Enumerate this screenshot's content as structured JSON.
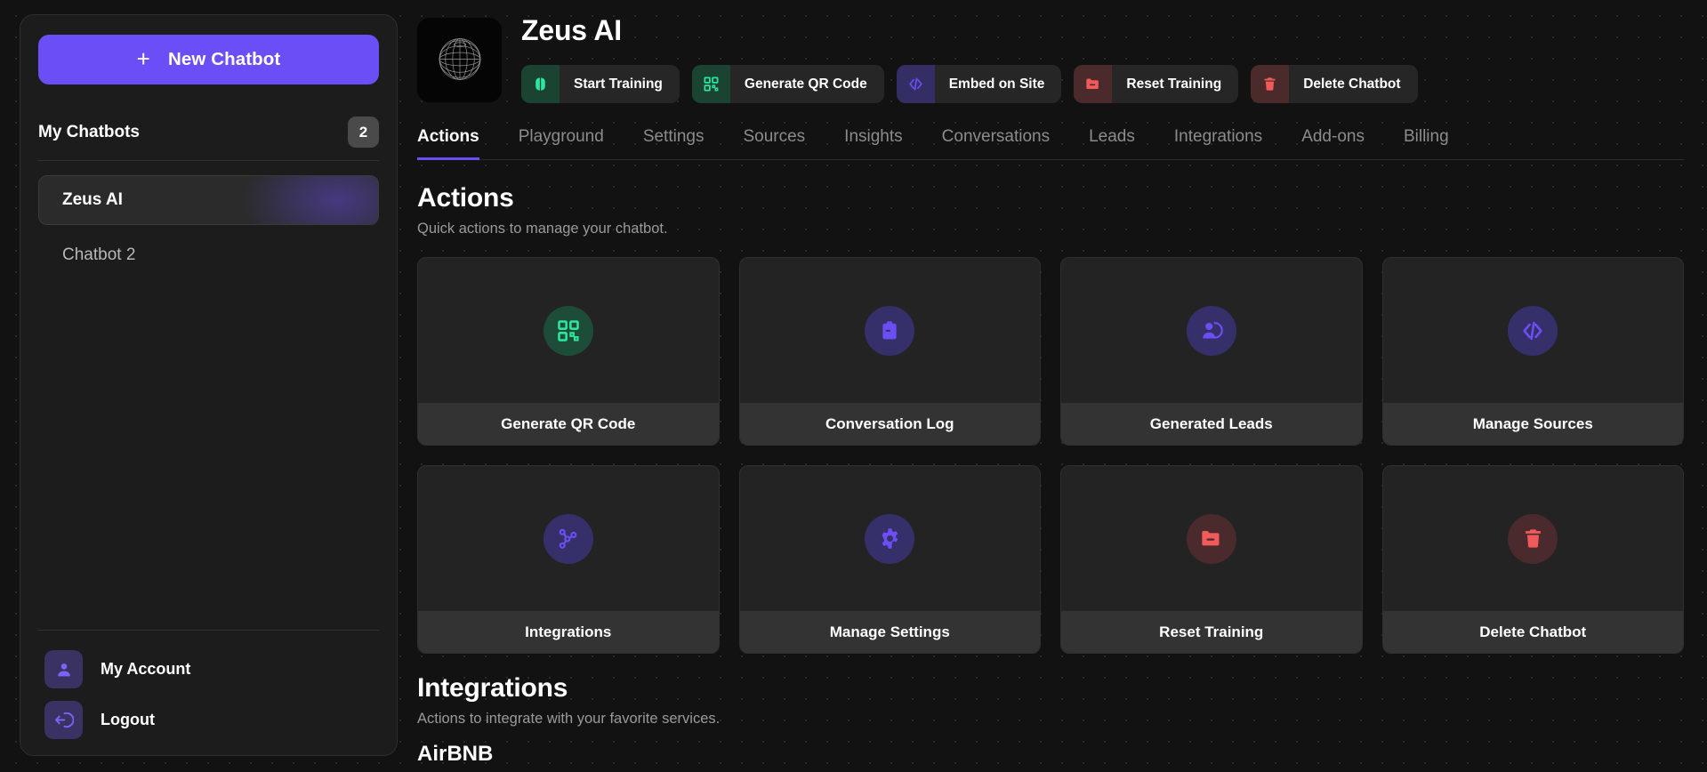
{
  "sidebar": {
    "new_chatbot_label": "New Chatbot",
    "new_chatbot_plus": "+",
    "my_chatbots_label": "My Chatbots",
    "my_chatbots_count": "2",
    "chatbots": [
      {
        "name": "Zeus AI",
        "active": true
      },
      {
        "name": "Chatbot 2",
        "active": false
      }
    ],
    "footer": [
      {
        "label": "My Account",
        "icon": "user-icon"
      },
      {
        "label": "Logout",
        "icon": "logout-icon"
      }
    ]
  },
  "header": {
    "bot_name": "Zeus AI",
    "avatar_icon": "globe-wireframe-icon",
    "buttons": [
      {
        "label": "Start Training",
        "icon": "brain-icon",
        "tone": "green"
      },
      {
        "label": "Generate QR Code",
        "icon": "qr-code-icon",
        "tone": "green"
      },
      {
        "label": "Embed on Site",
        "icon": "code-icon",
        "tone": "purple"
      },
      {
        "label": "Reset Training",
        "icon": "folder-minus-icon",
        "tone": "red"
      },
      {
        "label": "Delete Chatbot",
        "icon": "trash-icon",
        "tone": "red"
      }
    ]
  },
  "tabs": [
    {
      "label": "Actions",
      "active": true
    },
    {
      "label": "Playground",
      "active": false
    },
    {
      "label": "Settings",
      "active": false
    },
    {
      "label": "Sources",
      "active": false
    },
    {
      "label": "Insights",
      "active": false
    },
    {
      "label": "Conversations",
      "active": false
    },
    {
      "label": "Leads",
      "active": false
    },
    {
      "label": "Integrations",
      "active": false
    },
    {
      "label": "Add-ons",
      "active": false
    },
    {
      "label": "Billing",
      "active": false
    }
  ],
  "actions_section": {
    "title": "Actions",
    "subtitle": "Quick actions to manage your chatbot.",
    "cards": [
      {
        "label": "Generate QR Code",
        "icon": "qr-code-icon",
        "tone": "green"
      },
      {
        "label": "Conversation Log",
        "icon": "clipboard-icon",
        "tone": "purple"
      },
      {
        "label": "Generated Leads",
        "icon": "user-add-icon",
        "tone": "purple"
      },
      {
        "label": "Manage Sources",
        "icon": "code-icon",
        "tone": "purple"
      },
      {
        "label": "Integrations",
        "icon": "network-icon",
        "tone": "purple"
      },
      {
        "label": "Manage Settings",
        "icon": "gear-icon",
        "tone": "purple"
      },
      {
        "label": "Reset Training",
        "icon": "folder-minus-icon",
        "tone": "red"
      },
      {
        "label": "Delete Chatbot",
        "icon": "trash-icon",
        "tone": "red"
      }
    ]
  },
  "integrations_section": {
    "title": "Integrations",
    "subtitle": "Actions to integrate with your favorite services.",
    "items": [
      {
        "name": "AirBNB"
      }
    ]
  },
  "colors": {
    "accent_purple": "#6c4ef6",
    "accent_green": "#2ee59d",
    "accent_red": "#f05a5a",
    "page_bg": "#121212",
    "panel_bg": "#1c1c1c",
    "card_bg": "#232323",
    "card_foot_bg": "#333333"
  }
}
